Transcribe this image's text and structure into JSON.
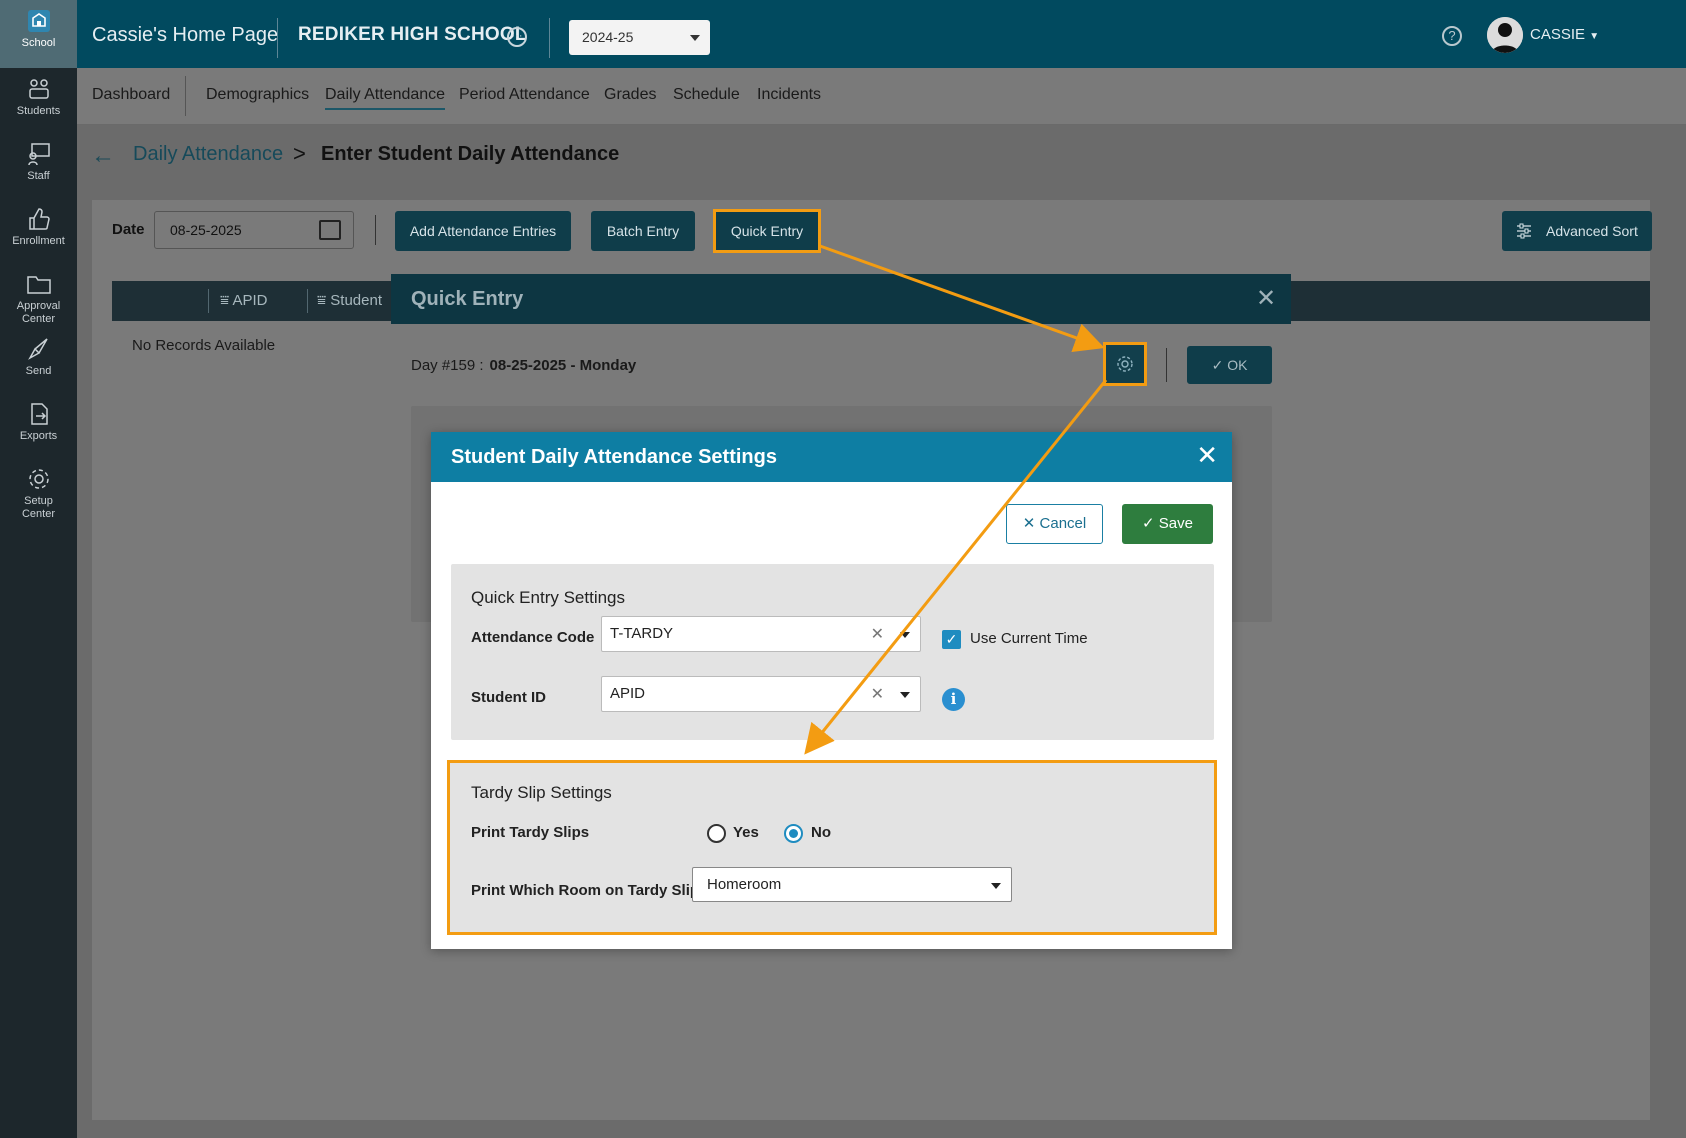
{
  "sidebar": {
    "items": [
      {
        "label": "School",
        "icon": "school-icon"
      },
      {
        "label": "Students",
        "icon": "students-icon"
      },
      {
        "label": "Staff",
        "icon": "staff-icon"
      },
      {
        "label": "Enrollment",
        "icon": "thumbs-up-icon"
      },
      {
        "label": "Approval\nCenter",
        "icon": "folder-icon"
      },
      {
        "label": "Send",
        "icon": "send-icon"
      },
      {
        "label": "Exports",
        "icon": "export-icon"
      },
      {
        "label": "Setup\nCenter",
        "icon": "gear-icon"
      }
    ]
  },
  "topbar": {
    "home_label": "Cassie's Home Page",
    "school_name": "REDIKER HIGH SCHOOL",
    "year": "2024-25",
    "user": "CASSIE",
    "help": "?"
  },
  "nav": {
    "items": [
      "Dashboard",
      "Demographics",
      "Daily Attendance",
      "Period Attendance",
      "Grades",
      "Schedule",
      "Incidents"
    ],
    "active": "Daily Attendance"
  },
  "breadcrumb": {
    "back": "←",
    "parent": "Daily Attendance",
    "separator": ">",
    "current": "Enter Student Daily Attendance"
  },
  "toolbar": {
    "date_label": "Date",
    "date_value": "08-25-2025",
    "add_entries": "Add Attendance Entries",
    "batch_entry": "Batch Entry",
    "quick_entry": "Quick Entry",
    "advanced_sort": "Advanced Sort"
  },
  "grid": {
    "columns": [
      "APID",
      "Student"
    ],
    "empty_text": "No Records Available"
  },
  "quick_entry_modal": {
    "title": "Quick Entry",
    "day_label": "Day #159 :",
    "day_value": "08-25-2025 - Monday",
    "ok": "OK"
  },
  "settings_modal": {
    "title": "Student Daily Attendance Settings",
    "cancel": "Cancel",
    "save": "Save",
    "quick_entry_settings": {
      "title": "Quick Entry Settings",
      "attendance_code_label": "Attendance Code",
      "attendance_code_value": "T-TARDY",
      "use_current_time_label": "Use Current Time",
      "use_current_time_checked": true,
      "student_id_label": "Student ID",
      "student_id_value": "APID"
    },
    "tardy_slip_settings": {
      "title": "Tardy Slip Settings",
      "print_label": "Print Tardy Slips",
      "yes": "Yes",
      "no": "No",
      "selected": "No",
      "room_label": "Print Which Room on Tardy Slips",
      "room_value": "Homeroom"
    }
  },
  "colors": {
    "highlight": "#f39c12",
    "header_teal": "#0e7ea3",
    "save_green": "#2e7d3e"
  }
}
